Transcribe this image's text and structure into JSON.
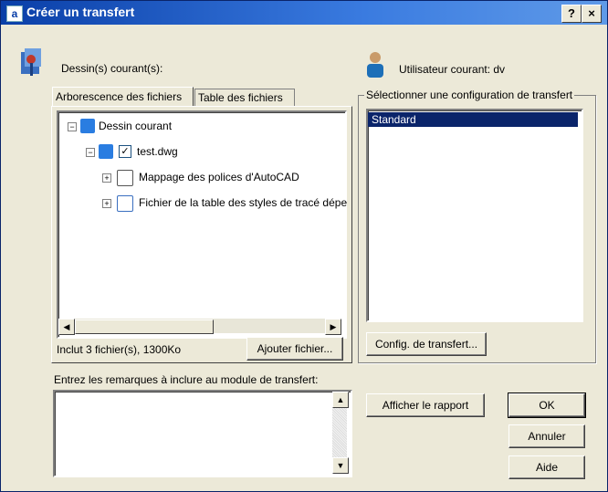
{
  "window": {
    "title": "Créer un transfert",
    "help_label": "?",
    "close_label": "×"
  },
  "current_drawings_label": "Dessin(s) courant(s):",
  "current_user_label": "Utilisateur courant: dv",
  "tabs": [
    {
      "label": "Arborescence des fichiers",
      "active": true
    },
    {
      "label": "Table des fichiers",
      "active": false
    }
  ],
  "tree": {
    "root": "Dessin courant",
    "file": "test.dwg",
    "children": [
      "Mappage des polices d'AutoCAD",
      "Fichier de la table des styles de tracé dépe"
    ]
  },
  "summary_text": "Inclut 3 fichier(s), 1300Ko",
  "add_file_button": "Ajouter fichier...",
  "config_group_label": "Sélectionner une configuration de transfert",
  "configs": [
    {
      "label": "Standard",
      "selected": true
    }
  ],
  "config_button": "Config. de transfert...",
  "notes_label": "Entrez les remarques à inclure au module de transfert:",
  "notes_value": "",
  "buttons": {
    "report": "Afficher le rapport",
    "ok": "OK",
    "cancel": "Annuler",
    "help": "Aide"
  },
  "colors": {
    "titlebar": "#0a3fa8",
    "selection": "#0a246a",
    "dialog_bg": "#ece9d8"
  }
}
